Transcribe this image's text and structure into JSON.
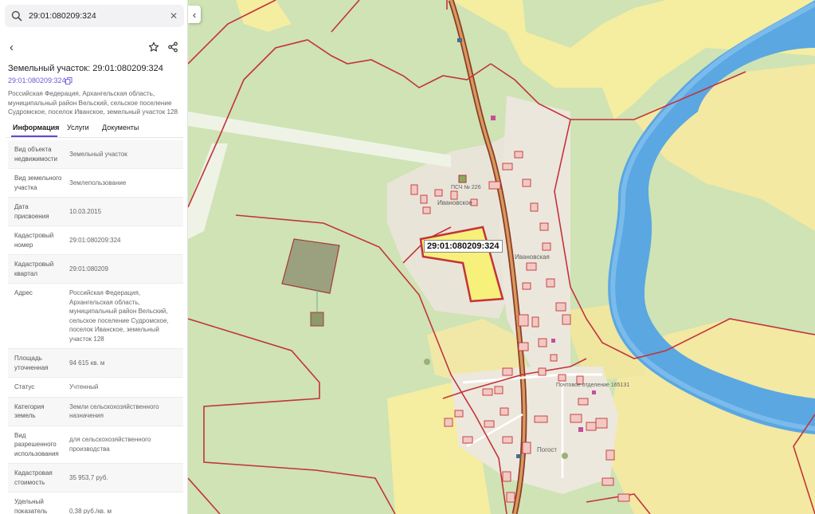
{
  "search": {
    "value": "29:01:080209:324",
    "placeholder": ""
  },
  "panel": {
    "title": "Земельный участок: 29:01:080209:324",
    "number_link": "29:01:080209:324",
    "address_top": "Российская Федерация, Архангельская область, муниципальный район Вельский, сельское поселение Судромское, поселок Иванское, земельный участок 128",
    "tabs": [
      {
        "label": "Информация"
      },
      {
        "label": "Услуги"
      },
      {
        "label": "Документы"
      }
    ],
    "rows": [
      {
        "k": "Вид объекта недвижимости",
        "v": "Земельный участок"
      },
      {
        "k": "Вид земельного участка",
        "v": "Землепользование"
      },
      {
        "k": "Дата присвоения",
        "v": "10.03.2015"
      },
      {
        "k": "Кадастровый номер",
        "v": "29:01:080209:324"
      },
      {
        "k": "Кадастровый квартал",
        "v": "29:01:080209"
      },
      {
        "k": "Адрес",
        "v": "Российская Федерация, Архангельская область, муниципальный район Вельский, сельское поселение Судромское, поселок Иванское, земельный участок 128"
      },
      {
        "k": "Площадь уточненная",
        "v": "94 615 кв. м"
      },
      {
        "k": "Статус",
        "v": "Учтенный"
      },
      {
        "k": "Категория земель",
        "v": "Земли сельскохозяйственного назначения"
      },
      {
        "k": "Вид разрешенного использования",
        "v": "для сельскохозяйственного производства"
      },
      {
        "k": "Кадастровая стоимость",
        "v": "35 953,7 руб."
      },
      {
        "k": "Удельный показатель кадастровой",
        "v": "0,38 руб./кв. м"
      }
    ]
  },
  "map": {
    "parcel_label": "29:01:080209:324",
    "labels": {
      "ivanovskoe": "Ивановское",
      "ivanovskaya": "Ивановская",
      "pogost": "Погост",
      "psch": "ПСЧ № 226",
      "ptu": "Почтовое отделение 165131"
    }
  },
  "colors": {
    "accent": "#5d48d6",
    "forest": "#cfe3b4",
    "field": "#f5eda0",
    "river": "#5aa7e2",
    "boundary": "#c3333b",
    "selected_parcel": "#f7f07a"
  },
  "icons": [
    "search-icon",
    "close-icon",
    "back-icon",
    "star-icon",
    "share-icon",
    "copy-icon",
    "chevron-left-icon"
  ]
}
